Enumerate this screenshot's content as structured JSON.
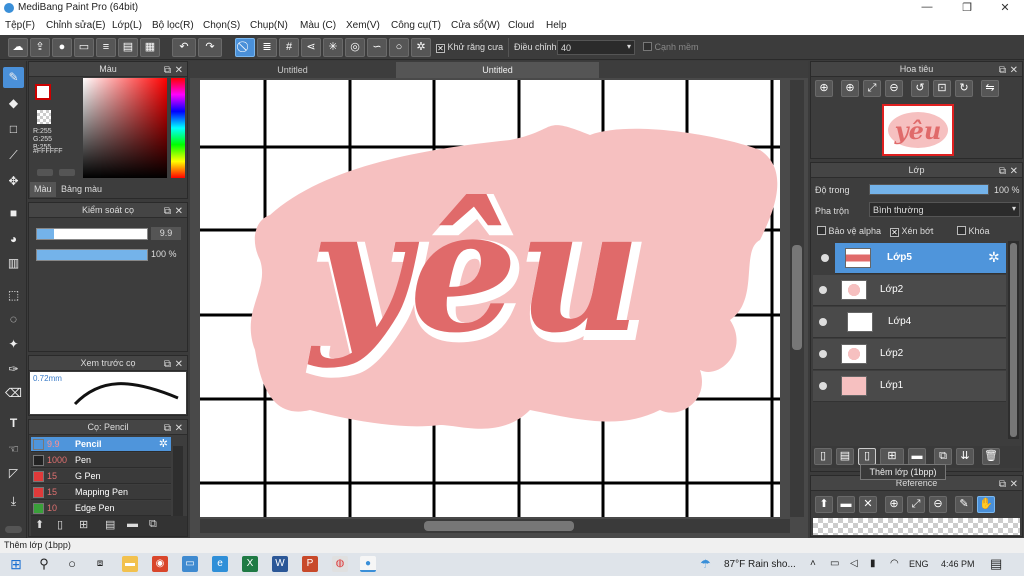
{
  "window": {
    "title": "MediBang Paint Pro (64bit)",
    "minimize": "—",
    "maximize": "❐",
    "close": "✕"
  },
  "menu": [
    "Tệp(F)",
    "Chỉnh sửa(E)",
    "Lớp(L)",
    "Bộ lọc(R)",
    "Chọn(S)",
    "Chụp(N)",
    "Màu (C)",
    "Xem(V)",
    "Công cụ(T)",
    "Cửa sổ(W)",
    "Cloud",
    "Help"
  ],
  "toolbar": {
    "antialias_label": "Khử răng cưa",
    "adjust_label": "Điều chỉnh",
    "adjust_value": "40",
    "smooth_label": "Cạnh mềm"
  },
  "color_panel": {
    "title": "Màu",
    "r": "R:255",
    "g": "G:255",
    "b": "B:255",
    "hex": "#FFFFFF",
    "tab_color": "Màu",
    "tab_palette": "Bảng màu"
  },
  "brush_control": {
    "title": "Kiểm soát cọ",
    "size": "9.9",
    "opacity": "100 %",
    "size_fraction": 0.15,
    "opacity_fraction": 1.0
  },
  "brush_preview": {
    "title": "Xem trước cọ",
    "size": "0.72mm"
  },
  "brush_list": {
    "title": "Cọ: Pencil",
    "items": [
      {
        "size": "9.9",
        "name": "Pencil",
        "color": "#4f95db",
        "selected": true
      },
      {
        "size": "1000",
        "name": "Pen",
        "color": "#222222",
        "selected": false
      },
      {
        "size": "15",
        "name": "G Pen",
        "color": "#e03a3a",
        "selected": false
      },
      {
        "size": "15",
        "name": "Mapping Pen",
        "color": "#e03a3a",
        "selected": false
      },
      {
        "size": "10",
        "name": "Edge Pen",
        "color": "#3aa03a",
        "selected": false
      }
    ]
  },
  "tabs": [
    "Untitled",
    "Untitled"
  ],
  "canvas": {
    "text": "yêu"
  },
  "navigator": {
    "title": "Hoa tiêu",
    "thumb_text": "yêu"
  },
  "layers": {
    "title": "Lớp",
    "opacity_label": "Độ trong",
    "opacity_value": "100 %",
    "opacity_fraction": 1.0,
    "blend_label": "Pha trộn",
    "blend_value": "Bình thường",
    "protect_alpha": "Bảo vệ alpha",
    "clipping": "Xén bớt",
    "lock": "Khóa",
    "items": [
      {
        "name": "Lớp5",
        "selected": true
      },
      {
        "name": "Lớp2",
        "selected": false
      },
      {
        "name": "Lớp4",
        "selected": false
      },
      {
        "name": "Lớp2",
        "selected": false
      },
      {
        "name": "Lớp1",
        "selected": false
      }
    ],
    "tooltip": "Thêm lớp (1bpp)"
  },
  "reference": {
    "title": "Reference"
  },
  "status": {
    "text": "Thêm lớp (1bpp)"
  },
  "taskbar": {
    "weather": "87°F  Rain sho...",
    "lang": "ENG",
    "time": "4:46 PM"
  },
  "colors": {
    "accent": "#4f95db",
    "canvas_pink": "#f6c0c0",
    "letter_red": "#e06a6a"
  }
}
